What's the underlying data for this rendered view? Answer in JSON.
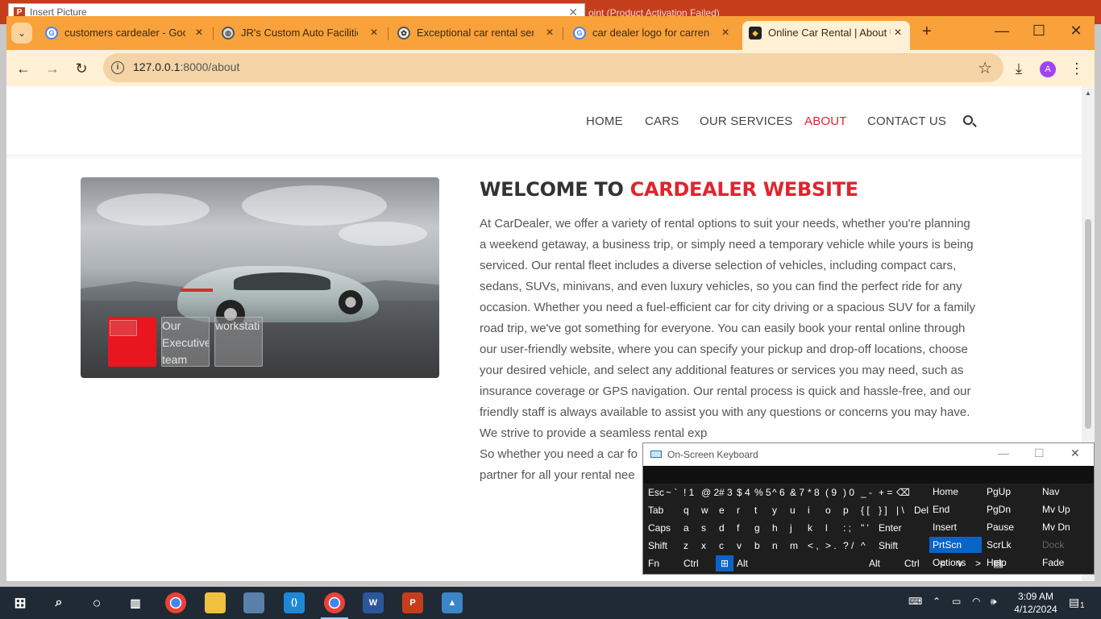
{
  "background_window": {
    "dialog_title": "Insert Picture",
    "app_title_fragment": "oint (Product Activation Failed)"
  },
  "browser": {
    "tabs": [
      {
        "title": "customers cardealer - Goog",
        "icon": "google-icon"
      },
      {
        "title": "JR's Custom Auto Facilities",
        "icon": "globe-icon"
      },
      {
        "title": "Exceptional car rental servic",
        "icon": "chatgpt-icon"
      },
      {
        "title": "car dealer logo for carrenta",
        "icon": "google-icon"
      },
      {
        "title": "Online Car Rental | About U",
        "icon": "site-icon",
        "active": true
      }
    ],
    "url_host": "127.0.0.1",
    "url_path": ":8000/about",
    "profile_initial": "A",
    "accent_color": "#f9a13a"
  },
  "site": {
    "nav": [
      "HOME",
      "CARS",
      "OUR SERVICES",
      "ABOUT",
      "CONTACT US"
    ],
    "active_nav": "ABOUT",
    "thumbnails": [
      {
        "alt": ""
      },
      {
        "alt": "Our Executive team"
      },
      {
        "alt": "workstati"
      }
    ],
    "heading_prefix": "WELCOME TO",
    "heading_highlight": "CARDEALER WEBSITE",
    "paragraph": "At CarDealer, we offer a variety of rental options to suit your needs, whether you're planning a weekend getaway, a business trip, or simply need a temporary vehicle while yours is being serviced. Our rental fleet includes a diverse selection of vehicles, including compact cars, sedans, SUVs, minivans, and even luxury vehicles, so you can find the perfect ride for any occasion. Whether you need a fuel-efficient car for city driving or a spacious SUV for a family road trip, we've got something for everyone. You can easily book your rental online through our user-friendly website, where you can specify your pickup and drop-off locations, choose your desired vehicle, and select any additional features or services you may need, such as insurance coverage or GPS navigation. Our rental process is quick and hassle-free, and our friendly staff is always available to assist you with any questions or concerns you may have. We strive to provide a seamless rental exp",
    "para_line2_a": "So whether you need a car fo",
    "para_line3_a": "partner for all your rental nee",
    "brand_red": "#e0242f"
  },
  "osk": {
    "title": "On-Screen Keyboard",
    "rows": [
      [
        "Esc",
        "~ `",
        "! 1",
        "@ 2",
        "# 3",
        "$ 4",
        "% 5",
        "^ 6",
        "& 7",
        "* 8",
        "( 9",
        ") 0",
        "_ -",
        "+ =",
        "⌫"
      ],
      [
        "Tab",
        "q",
        "w",
        "e",
        "r",
        "t",
        "y",
        "u",
        "i",
        "o",
        "p",
        "{ [",
        "} ]",
        "| \\",
        "Del"
      ],
      [
        "Caps",
        "a",
        "s",
        "d",
        "f",
        "g",
        "h",
        "j",
        "k",
        "l",
        ": ;",
        "\" '",
        "Enter"
      ],
      [
        "Shift",
        "z",
        "x",
        "c",
        "v",
        "b",
        "n",
        "m",
        "< ,",
        "> .",
        "? /",
        "^",
        "Shift"
      ],
      [
        "Fn",
        "Ctrl",
        "⊞",
        "Alt",
        "",
        "Alt",
        "Ctrl",
        "<",
        "v",
        ">",
        "▤"
      ]
    ],
    "side": [
      [
        "Home",
        "PgUp",
        "Nav"
      ],
      [
        "End",
        "PgDn",
        "Mv Up"
      ],
      [
        "Insert",
        "Pause",
        "Mv Dn"
      ],
      [
        "PrtScn",
        "ScrLk",
        "Dock"
      ],
      [
        "Options",
        "Help",
        "Fade"
      ]
    ]
  },
  "taskbar": {
    "time": "3:09 AM",
    "date": "4/12/2024",
    "notification_count": "1"
  }
}
